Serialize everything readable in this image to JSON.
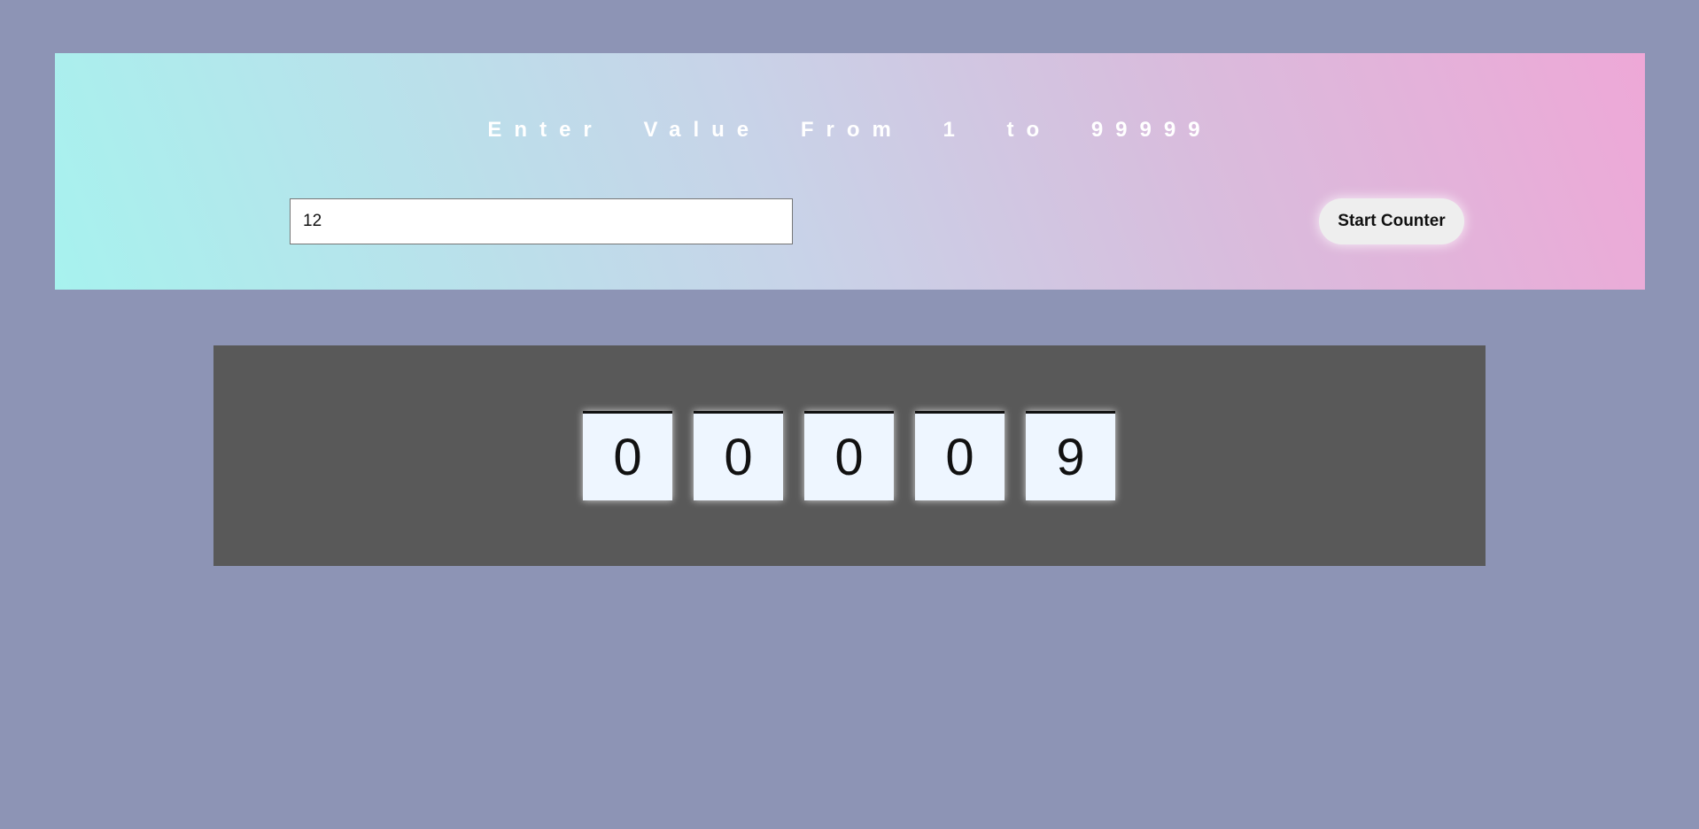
{
  "banner": {
    "title": "Enter Value From 1 to 99999",
    "input_value": "12",
    "button_label": "Start Counter"
  },
  "counter": {
    "digits": [
      "0",
      "0",
      "0",
      "0",
      "9"
    ]
  },
  "colors": {
    "page_background": "#8d94b5",
    "gradient_start": "#a7f2ee",
    "gradient_end": "#eea8d7",
    "panel_background": "#595959",
    "digit_background": "#eef6ff"
  }
}
